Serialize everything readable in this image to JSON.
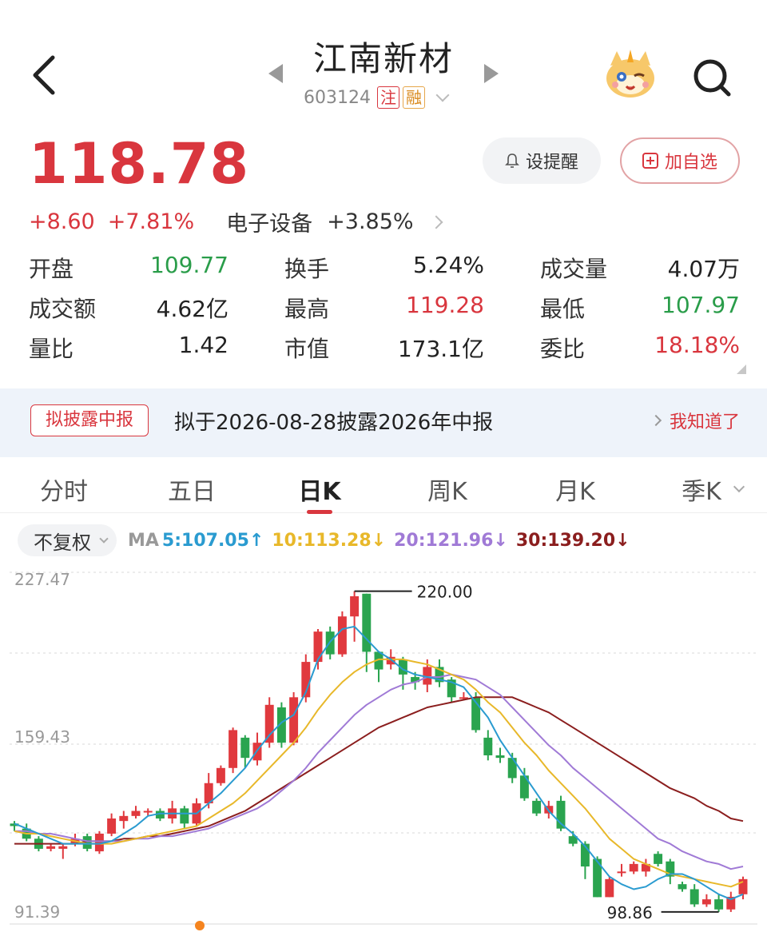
{
  "header": {
    "title": "江南新材",
    "code": "603124",
    "tag_zhu": "注",
    "tag_rong": "融"
  },
  "quote": {
    "price": "118.78",
    "change": "+8.60",
    "change_pct": "+7.81%",
    "sector": "电子设备",
    "sector_pct": "+3.85%",
    "alert_label": "设提醒",
    "add_label": "加自选"
  },
  "stats": [
    [
      {
        "label": "开盘",
        "value": "109.77",
        "color": "down"
      },
      {
        "label": "换手",
        "value": "5.24%",
        "color": ""
      },
      {
        "label": "成交量",
        "value": "4.07万",
        "color": ""
      }
    ],
    [
      {
        "label": "成交额",
        "value": "4.62亿",
        "color": ""
      },
      {
        "label": "最高",
        "value": "119.28",
        "color": "up"
      },
      {
        "label": "最低",
        "value": "107.97",
        "color": "down"
      }
    ],
    [
      {
        "label": "量比",
        "value": "1.42",
        "color": ""
      },
      {
        "label": "市值",
        "value": "173.1亿",
        "color": ""
      },
      {
        "label": "委比",
        "value": "18.18%",
        "color": "up"
      }
    ]
  ],
  "notice": {
    "tag": "拟披露中报",
    "text": "拟于2026-08-28披露2026年中报",
    "link": "我知道了"
  },
  "tabs": [
    "分时",
    "五日",
    "日K",
    "周K",
    "月K",
    "季K"
  ],
  "active_tab": 2,
  "ma": {
    "adjust": "不复权",
    "label": "MA",
    "ma5": "5:107.05↑",
    "ma10": "10:113.28↓",
    "ma20": "20:121.96↓",
    "ma30": "30:139.20↓"
  },
  "colors": {
    "up": "#e0393e",
    "down": "#2aa44f",
    "ma5": "#2a9bd0",
    "ma10": "#e8b82a",
    "ma20": "#a07ad6",
    "ma30": "#8b1e1e"
  },
  "chart_data": {
    "type": "candlestick",
    "y_labels": [
      "227.47",
      "159.43",
      "91.39"
    ],
    "ylim": [
      91.39,
      227.47
    ],
    "high_annotation": "220.00",
    "low_annotation": "98.86",
    "candles": [
      [
        128,
        127,
        129,
        125
      ],
      [
        126,
        122,
        128,
        121
      ],
      [
        122,
        118,
        123,
        117
      ],
      [
        118,
        119,
        120,
        117
      ],
      [
        118,
        119,
        120,
        114
      ],
      [
        120,
        122,
        124,
        119
      ],
      [
        123,
        118,
        124,
        117
      ],
      [
        117,
        124,
        125,
        116
      ],
      [
        124,
        130,
        132,
        123
      ],
      [
        129,
        131,
        133,
        126
      ],
      [
        131,
        133,
        135,
        130
      ],
      [
        133,
        133,
        134,
        131
      ],
      [
        133,
        130,
        134,
        129
      ],
      [
        130,
        134,
        137,
        128
      ],
      [
        134,
        128,
        135,
        126
      ],
      [
        128,
        136,
        138,
        127
      ],
      [
        136,
        144,
        148,
        134
      ],
      [
        144,
        150,
        151,
        143
      ],
      [
        150,
        165,
        166,
        148
      ],
      [
        162,
        154,
        163,
        150
      ],
      [
        153,
        160,
        164,
        151
      ],
      [
        160,
        175,
        178,
        158
      ],
      [
        174,
        160,
        176,
        158
      ],
      [
        160,
        178,
        180,
        159
      ],
      [
        178,
        192,
        195,
        176
      ],
      [
        192,
        204,
        205,
        189
      ],
      [
        204,
        195,
        206,
        193
      ],
      [
        195,
        210,
        212,
        194
      ],
      [
        210,
        218,
        220,
        200
      ],
      [
        219,
        196,
        219,
        188
      ],
      [
        196,
        189,
        196,
        184
      ],
      [
        191,
        194,
        197,
        189
      ],
      [
        193,
        187,
        194,
        181
      ],
      [
        186,
        184,
        188,
        181
      ],
      [
        183,
        190,
        193,
        180
      ],
      [
        190,
        184,
        193,
        182
      ],
      [
        185,
        178,
        186,
        176
      ],
      [
        178,
        178,
        180,
        177
      ],
      [
        178,
        165,
        180,
        164
      ],
      [
        162,
        155,
        165,
        153
      ],
      [
        155,
        154,
        158,
        152
      ],
      [
        154,
        146,
        156,
        144
      ],
      [
        147,
        138,
        150,
        137
      ],
      [
        137,
        132,
        138,
        131
      ],
      [
        132,
        135,
        137,
        130
      ],
      [
        137,
        126,
        139,
        125
      ],
      [
        123,
        120,
        125,
        119
      ],
      [
        120,
        111,
        121,
        106
      ],
      [
        114,
        98.86,
        115,
        98.86
      ],
      [
        98.86,
        106,
        107,
        98.86
      ],
      [
        109,
        109,
        112,
        107
      ],
      [
        109,
        112,
        113,
        108
      ],
      [
        109,
        112,
        114,
        107
      ],
      [
        116,
        112,
        117,
        111
      ],
      [
        113,
        107,
        114,
        104
      ],
      [
        104,
        102,
        105,
        101
      ],
      [
        102,
        96,
        104,
        95
      ],
      [
        96,
        98,
        100,
        95
      ],
      [
        98,
        94,
        100,
        93
      ],
      [
        94,
        99,
        101,
        93
      ],
      [
        100,
        106,
        107,
        98
      ]
    ],
    "ma5": [
      128,
      126,
      124,
      122,
      120,
      120,
      120,
      120,
      121,
      124,
      127,
      131,
      132,
      132,
      132,
      132,
      136,
      140,
      145,
      150,
      157,
      163,
      168,
      171,
      180,
      193,
      200,
      205,
      206,
      201,
      196,
      193,
      189,
      187,
      186,
      185,
      184,
      182,
      176,
      170,
      161,
      154,
      147,
      140,
      133,
      128,
      124,
      119,
      113,
      107,
      104,
      102,
      103,
      106,
      108,
      108,
      106,
      103,
      100,
      98,
      100
    ],
    "ma10": [
      125,
      124,
      124,
      123,
      122,
      121,
      120,
      120,
      120,
      121,
      122,
      123,
      124,
      125,
      126,
      127,
      130,
      133,
      136,
      140,
      145,
      150,
      155,
      160,
      166,
      173,
      179,
      184,
      188,
      191,
      193,
      193,
      193,
      192,
      191,
      189,
      187,
      185,
      181,
      176,
      172,
      166,
      160,
      155,
      149,
      144,
      139,
      134,
      128,
      122,
      118,
      114,
      112,
      110,
      108,
      107,
      106,
      105,
      104,
      103,
      105
    ],
    "ma20": [
      125,
      125,
      124,
      124,
      123,
      122,
      121,
      121,
      121,
      121,
      122,
      122,
      123,
      123,
      124,
      125,
      126,
      128,
      130,
      132,
      134,
      137,
      141,
      145,
      150,
      156,
      161,
      166,
      171,
      175,
      178,
      181,
      183,
      184,
      186,
      186,
      187,
      186,
      185,
      182,
      179,
      174,
      169,
      164,
      159,
      155,
      150,
      146,
      142,
      138,
      134,
      130,
      126,
      122,
      120,
      117,
      115,
      113,
      112,
      110,
      111
    ],
    "ma30": [
      120,
      120,
      120,
      120,
      120,
      120,
      121,
      121,
      121,
      122,
      122,
      123,
      123,
      124,
      125,
      126,
      127,
      129,
      131,
      133,
      136,
      139,
      142,
      145,
      148,
      151,
      154,
      157,
      160,
      163,
      166,
      168,
      170,
      172,
      174,
      175,
      176,
      177,
      178,
      178,
      178,
      178,
      176,
      174,
      172,
      169,
      166,
      163,
      160,
      157,
      154,
      151,
      148,
      145,
      142,
      140,
      138,
      135,
      133,
      130,
      129
    ]
  }
}
